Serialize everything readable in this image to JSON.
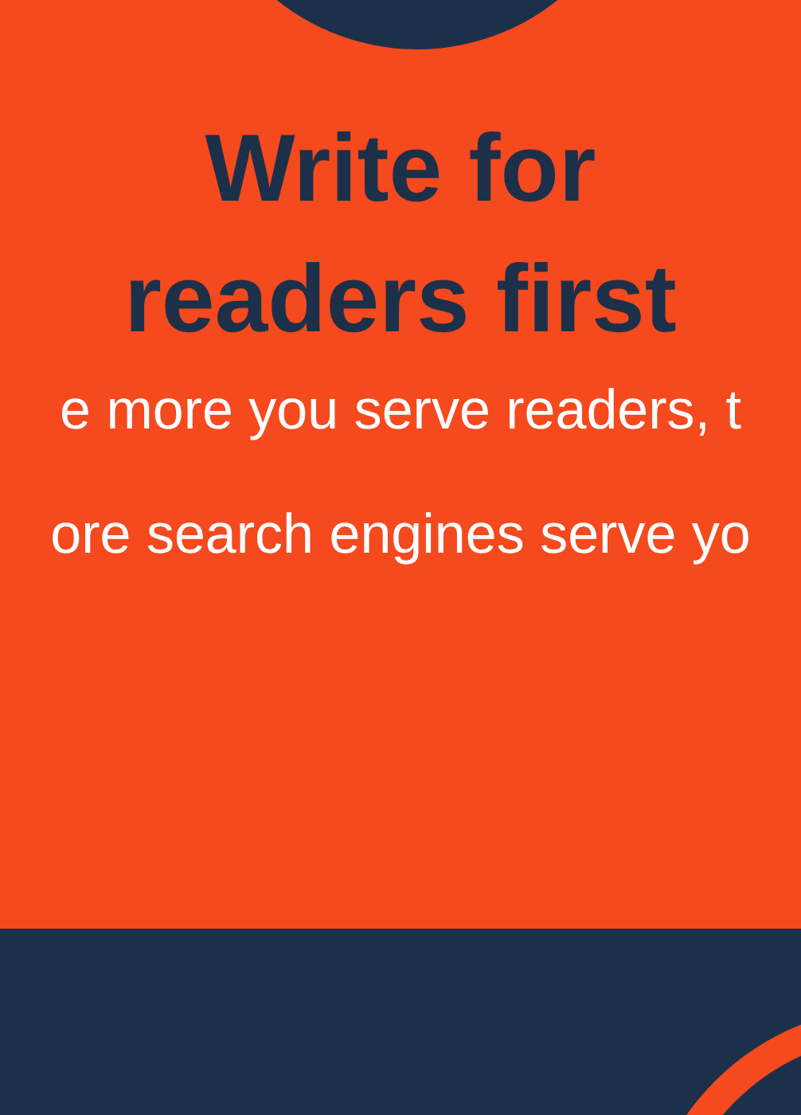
{
  "heading": {
    "lines": [
      "Write for",
      "readers first"
    ]
  },
  "subtitle": {
    "lines": [
      "e more you serve readers, t",
      "ore search engines serve yo"
    ]
  }
}
